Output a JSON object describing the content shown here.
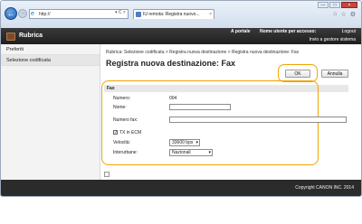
{
  "browser": {
    "address": "http://",
    "tab_title": "IU remota: Registra nuovo...",
    "tab_close": "×",
    "win_min": "—",
    "win_max": "□",
    "win_close": "×",
    "back": "←",
    "forward": "→",
    "tools": "▾ C ×"
  },
  "header": {
    "title": "Rubrica",
    "link_portal": "A portale",
    "user": "Nome utente per accesso:",
    "logout": "Logout",
    "admin": "Invio a gestore sistema"
  },
  "sidebar": {
    "items": [
      {
        "label": "Preferiti"
      },
      {
        "label": "Selezione codificata"
      }
    ]
  },
  "main": {
    "breadcrumb": "Rubrica: Selezione codificata > Registra nuova destinazione > Registra nuova destinazione: Fax",
    "title": "Registra nuova destinazione: Fax",
    "ok": "OK",
    "cancel": "Annulla",
    "section": "Fax",
    "labels": {
      "number": "Numero:",
      "name": "Nome:",
      "fax_number": "Numero fax:",
      "ecm": "TX in ECM",
      "speed": "Velocità:",
      "long_distance": "Interurbane:"
    },
    "values": {
      "number": "004",
      "name": "",
      "fax_number": "",
      "ecm_checked": "✓",
      "speed": "33600 bps",
      "long_distance": "Nazionali"
    }
  },
  "footer": {
    "copyright": "Copyright CANON INC. 2014"
  }
}
